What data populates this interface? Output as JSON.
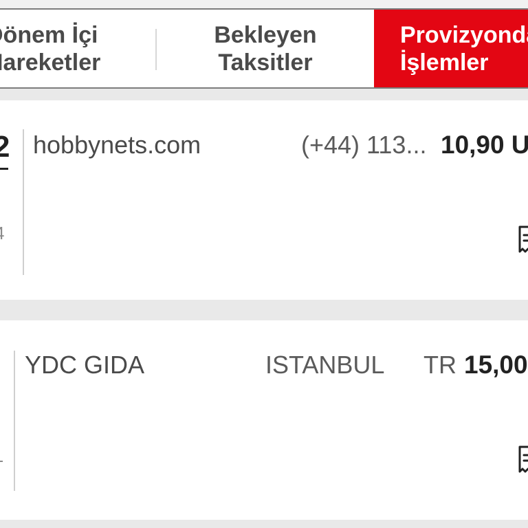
{
  "tabs": [
    {
      "label": "Dönem İçi\nHareketler",
      "active": false
    },
    {
      "label": "Bekleyen\nTaksitler",
      "active": false
    },
    {
      "label": "Provizyondaki\nİşlemler",
      "active": true
    }
  ],
  "transactions": [
    {
      "date_day": "2",
      "date_year": "4",
      "merchant": "hobbynets.com",
      "location": "(+44) 113...",
      "currency_prefix": "",
      "amount": "10,90 U",
      "icon": "receipt-icon"
    },
    {
      "date_day": "",
      "date_year": "",
      "merchant": "YDC GIDA",
      "location": "ISTANBUL",
      "currency_prefix": "TR",
      "amount": "15,00",
      "icon": "receipt-icon"
    }
  ],
  "colors": {
    "accent": "#e30613",
    "background": "#e9e9e9",
    "card": "#ffffff"
  }
}
